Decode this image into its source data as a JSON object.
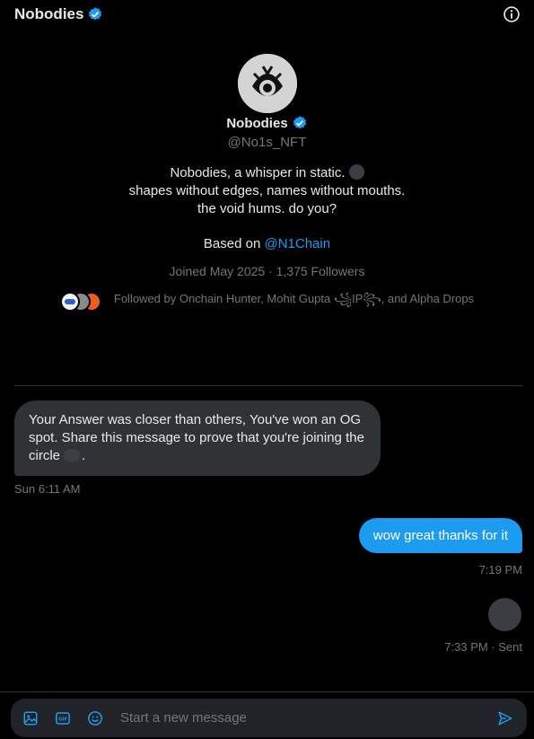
{
  "header": {
    "title": "Nobodies"
  },
  "profile": {
    "name": "Nobodies",
    "handle": "@No1s_NFT",
    "bio": [
      "Nobodies, a whisper in static.",
      "shapes without edges, names without mouths.",
      "the void hums. do you?"
    ],
    "based_prefix": "Based on ",
    "based_link": "@N1Chain",
    "joined": "Joined May 2025 · 1,375 Followers",
    "followed_by": "Followed by Onchain Hunter, Mohit Gupta ꧁IP꧂, and Alpha Drops"
  },
  "messages": {
    "incoming_text": "Your Answer was closer than others, You've won an OG spot. Share this message to prove that you're joining the circle",
    "incoming_suffix": ".",
    "incoming_time": "Sun 6:11 AM",
    "outgoing_text": "wow great thanks for it",
    "outgoing_time": "7:19 PM",
    "last_time": "7:33 PM · Sent"
  },
  "composer": {
    "placeholder": "Start a new message"
  },
  "colors": {
    "accent": "#1d9bf0",
    "bubble_in": "#2f3336",
    "bg": "#000000"
  },
  "icons": [
    "verified-badge-icon",
    "info-icon",
    "image-icon",
    "gif-icon",
    "emoji-icon",
    "send-icon"
  ]
}
